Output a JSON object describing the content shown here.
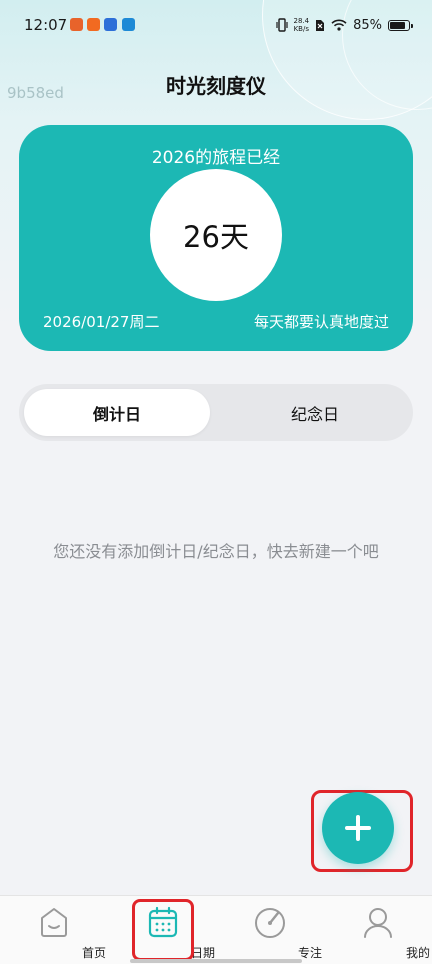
{
  "status_bar": {
    "time": "12:07",
    "net_speed_value": "28.4",
    "net_speed_unit": "KB/s",
    "battery": "85%"
  },
  "watermark": "9b58ed",
  "page_title": "时光刻度仪",
  "hero": {
    "title": "2026的旅程已经",
    "days": "26天",
    "date": "2026/01/27周二",
    "motto": "每天都要认真地度过",
    "color": "#1cb8b4"
  },
  "tabs": [
    {
      "label": "倒计日",
      "active": true
    },
    {
      "label": "纪念日",
      "active": false
    }
  ],
  "empty_message": "您还没有添加倒计日/纪念日，快去新建一个吧",
  "fab": {
    "icon": "plus-icon"
  },
  "bottom_nav": [
    {
      "label": "首页",
      "icon": "home-icon"
    },
    {
      "label": "日期",
      "icon": "calendar-icon",
      "active": true
    },
    {
      "label": "专注",
      "icon": "focus-timer-icon"
    },
    {
      "label": "我的",
      "icon": "person-icon"
    }
  ]
}
